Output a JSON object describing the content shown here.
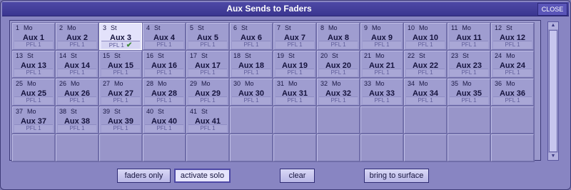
{
  "window": {
    "title": "Aux Sends to Faders",
    "close_label": "CLOSE"
  },
  "cells": [
    {
      "num": "1",
      "type": "Mo",
      "name": "Aux 1",
      "pfl": "PFL 1"
    },
    {
      "num": "2",
      "type": "Mo",
      "name": "Aux 2",
      "pfl": "PFL 1"
    },
    {
      "num": "3",
      "type": "St",
      "name": "Aux 3",
      "pfl": "PFL 1",
      "selected": true,
      "check": "✔"
    },
    {
      "num": "4",
      "type": "St",
      "name": "Aux 4",
      "pfl": "PFL 1"
    },
    {
      "num": "5",
      "type": "St",
      "name": "Aux 5",
      "pfl": "PFL 1"
    },
    {
      "num": "6",
      "type": "St",
      "name": "Aux 6",
      "pfl": "PFL 1"
    },
    {
      "num": "7",
      "type": "St",
      "name": "Aux 7",
      "pfl": "PFL 1"
    },
    {
      "num": "8",
      "type": "Mo",
      "name": "Aux 8",
      "pfl": "PFL 1"
    },
    {
      "num": "9",
      "type": "Mo",
      "name": "Aux 9",
      "pfl": "PFL 1"
    },
    {
      "num": "10",
      "type": "Mo",
      "name": "Aux 10",
      "pfl": "PFL 1"
    },
    {
      "num": "11",
      "type": "Mo",
      "name": "Aux 11",
      "pfl": "PFL 1"
    },
    {
      "num": "12",
      "type": "St",
      "name": "Aux 12",
      "pfl": "PFL 1"
    },
    {
      "num": "13",
      "type": "St",
      "name": "Aux 13",
      "pfl": "PFL 1"
    },
    {
      "num": "14",
      "type": "St",
      "name": "Aux 14",
      "pfl": "PFL 1"
    },
    {
      "num": "15",
      "type": "St",
      "name": "Aux 15",
      "pfl": "PFL 1"
    },
    {
      "num": "16",
      "type": "St",
      "name": "Aux 16",
      "pfl": "PFL 1"
    },
    {
      "num": "17",
      "type": "St",
      "name": "Aux 17",
      "pfl": "PFL 1"
    },
    {
      "num": "18",
      "type": "St",
      "name": "Aux 18",
      "pfl": "PFL 1"
    },
    {
      "num": "19",
      "type": "St",
      "name": "Aux 19",
      "pfl": "PFL 1"
    },
    {
      "num": "20",
      "type": "St",
      "name": "Aux 20",
      "pfl": "PFL 1"
    },
    {
      "num": "21",
      "type": "Mo",
      "name": "Aux 21",
      "pfl": "PFL 1"
    },
    {
      "num": "22",
      "type": "St",
      "name": "Aux 22",
      "pfl": "PFL 1"
    },
    {
      "num": "23",
      "type": "St",
      "name": "Aux 23",
      "pfl": "PFL 1"
    },
    {
      "num": "24",
      "type": "Mo",
      "name": "Aux 24",
      "pfl": "PFL 1"
    },
    {
      "num": "25",
      "type": "Mo",
      "name": "Aux 25",
      "pfl": "PFL 1"
    },
    {
      "num": "26",
      "type": "Mo",
      "name": "Aux 26",
      "pfl": "PFL 1"
    },
    {
      "num": "27",
      "type": "Mo",
      "name": "Aux 27",
      "pfl": "PFL 1"
    },
    {
      "num": "28",
      "type": "Mo",
      "name": "Aux 28",
      "pfl": "PFL 1"
    },
    {
      "num": "29",
      "type": "Mo",
      "name": "Aux 29",
      "pfl": "PFL 1"
    },
    {
      "num": "30",
      "type": "Mo",
      "name": "Aux 30",
      "pfl": "PFL 1"
    },
    {
      "num": "31",
      "type": "Mo",
      "name": "Aux 31",
      "pfl": "PFL 1"
    },
    {
      "num": "32",
      "type": "Mo",
      "name": "Aux 32",
      "pfl": "PFL 1"
    },
    {
      "num": "33",
      "type": "Mo",
      "name": "Aux 33",
      "pfl": "PFL 1"
    },
    {
      "num": "34",
      "type": "Mo",
      "name": "Aux 34",
      "pfl": "PFL 1"
    },
    {
      "num": "35",
      "type": "Mo",
      "name": "Aux 35",
      "pfl": "PFL 1"
    },
    {
      "num": "36",
      "type": "Mo",
      "name": "Aux 36",
      "pfl": "PFL 1"
    },
    {
      "num": "37",
      "type": "Mo",
      "name": "Aux 37",
      "pfl": "PFL 1"
    },
    {
      "num": "38",
      "type": "St",
      "name": "Aux 38",
      "pfl": "PFL 1"
    },
    {
      "num": "39",
      "type": "St",
      "name": "Aux 39",
      "pfl": "PFL 1"
    },
    {
      "num": "40",
      "type": "St",
      "name": "Aux 40",
      "pfl": "PFL 1"
    },
    {
      "num": "41",
      "type": "St",
      "name": "Aux 41",
      "pfl": "PFL 1"
    }
  ],
  "empty_cells": 19,
  "buttons": {
    "faders_only": "faders only",
    "activate_solo": "activate solo",
    "clear": "clear",
    "bring_to_surface": "bring to surface"
  },
  "scrollbar": {
    "up_icon": "▲",
    "down_icon": "▼"
  },
  "colors": {
    "window_bg": "#8885c2",
    "titlebar": "#4e49a6",
    "cell_bg": "#9f9dd0",
    "selected_cell_bg": "#e3e2fb",
    "check_color": "#3f8a3a"
  }
}
